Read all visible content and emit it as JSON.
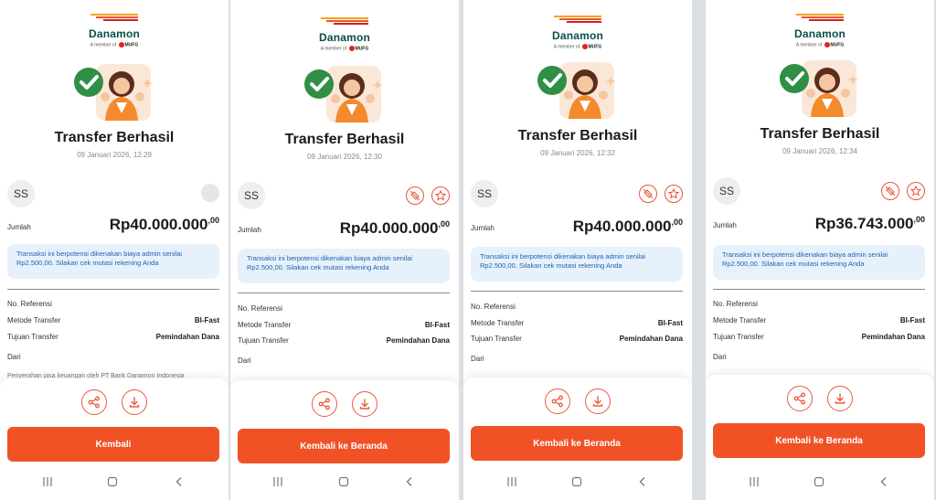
{
  "brand": {
    "name": "Danamon",
    "member_prefix": "A member of",
    "member_group": "MUFG",
    "accent": "#f05226",
    "brand_green": "#0c4d4a"
  },
  "screens": [
    {
      "title": "Transfer Berhasil",
      "datetime": "09 Januari 2026, 12:29",
      "avatar_initials": "SS",
      "amount_label": "Jumlah",
      "amount_main": "Rp40.000.000",
      "amount_cents": ",00",
      "notice": "Transaksi ini berpotensi dikenakan biaya admin senilai Rp2.500,00. Silakan cek mutasi rekening Anda",
      "rows": [
        {
          "label": "No. Referensi",
          "value": ""
        },
        {
          "label": "Metode Transfer",
          "value": "BI-Fast"
        },
        {
          "label": "Tujuan Transfer",
          "value": "Pemindahan Dana"
        },
        {
          "label": "Dari",
          "value": ""
        }
      ],
      "cut_text": "Penyerahan jasa keuangan oleh PT Bank Danamon Indonesia",
      "primary_button": "Kembali"
    },
    {
      "title": "Transfer Berhasil",
      "datetime": "09 Januari 2026, 12:30",
      "avatar_initials": "SS",
      "amount_label": "Jumlah",
      "amount_main": "Rp40.000.000",
      "amount_cents": ",00",
      "notice": "Transaksi ini berpotensi dikenakan biaya admin senilai Rp2.500,00. Silakan cek mutasi rekening Anda",
      "rows": [
        {
          "label": "No. Referensi",
          "value": ""
        },
        {
          "label": "Metode Transfer",
          "value": "BI-Fast"
        },
        {
          "label": "Tujuan Transfer",
          "value": "Pemindahan Dana"
        },
        {
          "label": "Dari",
          "value": ""
        }
      ],
      "cut_text": "",
      "primary_button": "Kembali ke Beranda"
    },
    {
      "title": "Transfer Berhasil",
      "datetime": "09 Januari 2026, 12:32",
      "avatar_initials": "SS",
      "amount_label": "Jumlah",
      "amount_main": "Rp40.000.000",
      "amount_cents": ",00",
      "notice": "Transaksi ini berpotensi dikenakan biaya admin senilai Rp2.500,00. Silakan cek mutasi rekening Anda",
      "rows": [
        {
          "label": "No. Referensi",
          "value": ""
        },
        {
          "label": "Metode Transfer",
          "value": "BI-Fast"
        },
        {
          "label": "Tujuan Transfer",
          "value": "Pemindahan Dana"
        },
        {
          "label": "Dari",
          "value": ""
        }
      ],
      "cut_text": "",
      "primary_button": "Kembali ke Beranda"
    },
    {
      "title": "Transfer Berhasil",
      "datetime": "09 Januari 2026, 12:34",
      "avatar_initials": "SS",
      "amount_label": "Jumlah",
      "amount_main": "Rp36.743.000",
      "amount_cents": ",00",
      "notice": "Transaksi ini berpotensi dikenakan biaya admin senilai Rp2.500,00. Silakan cek mutasi rekening Anda",
      "rows": [
        {
          "label": "No. Referensi",
          "value": ""
        },
        {
          "label": "Metode Transfer",
          "value": "BI-Fast"
        },
        {
          "label": "Tujuan Transfer",
          "value": "Pemindahan Dana"
        },
        {
          "label": "Dari",
          "value": ""
        }
      ],
      "cut_text": "",
      "primary_button": "Kembali ke Beranda"
    }
  ]
}
